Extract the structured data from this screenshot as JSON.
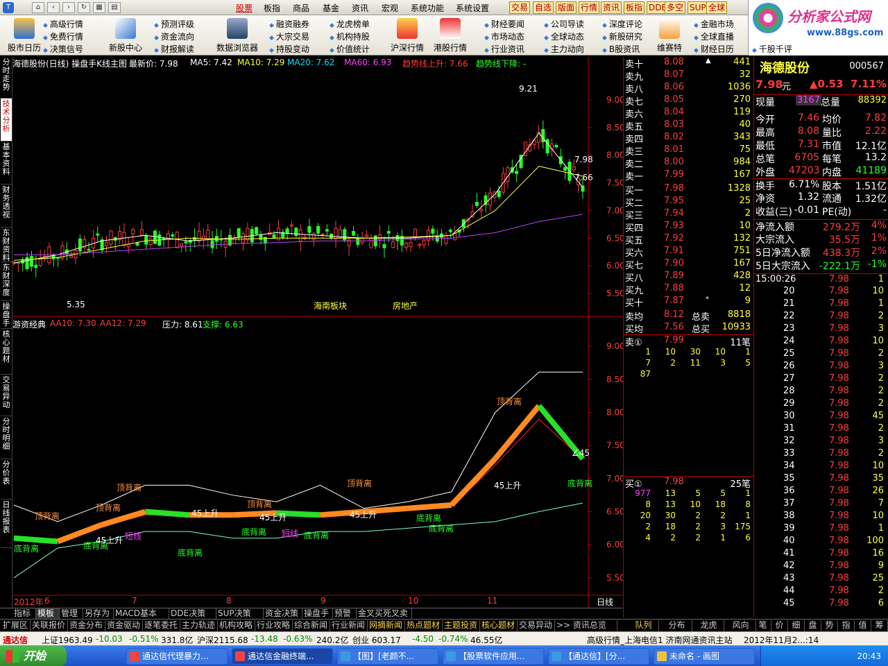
{
  "menu": {
    "items": [
      "股票",
      "板指",
      "商品",
      "基金",
      "资讯",
      "宏观",
      "系统功能",
      "系统设置"
    ],
    "active": "股票",
    "quick": [
      "交易",
      "自选",
      "版面",
      "行情",
      "资讯",
      "板指",
      "DDE",
      "多空",
      "SUP",
      "全球"
    ]
  },
  "toolbar": {
    "big": [
      "股市日历",
      "新股中心",
      "数据浏览器",
      "沪深行情",
      "港股行情",
      "维赛特"
    ],
    "small": [
      [
        "高级行情",
        "免费行情",
        "决策信号"
      ],
      [
        "预测评级",
        "资金流向",
        "财报解读"
      ],
      [
        "融资融券",
        "大宗交易",
        "持股变动"
      ],
      [
        "龙虎榜单",
        "机构持股",
        "价值统计"
      ],
      [
        "财经要闻",
        "市场动态",
        "行业资讯"
      ],
      [
        "公司导读",
        "全球动态",
        "主力动向"
      ],
      [
        "深度评论",
        "新股研究",
        "B股资讯"
      ],
      [
        "金融市场",
        "全球直播",
        "财经日历"
      ],
      [
        "千股千评"
      ]
    ]
  },
  "brand": {
    "title": "分析家公式网",
    "url": "www.88gs.com"
  },
  "side_tabs": [
    "分时走势",
    "技术分析",
    "基本资料",
    "财务透视",
    "东财资料",
    "东财深度",
    "操盘手",
    "核心题材",
    "交易异动",
    "分时明细",
    "分价表",
    "日线报表"
  ],
  "side_tab_active": "技术分析",
  "chart_header": {
    "title": "海德股份(日线) 操盘手K线主图",
    "last_label": "最新价: 7.98",
    "ma5": "MA5: 7.42",
    "ma10": "MA10: 7.29",
    "ma20": "MA20: 7.62",
    "ma60": "MA60: 6.93",
    "up": "趋势线上升: 7.66",
    "down": "趋势线下降: -"
  },
  "chart_labels": {
    "low": "5.35",
    "high": "9.21",
    "board1": "海南板块",
    "board2": "房地产",
    "right_last": "7.98",
    "right_trend": "7.66"
  },
  "sub_header": {
    "name": "游资经典",
    "aa10": "AA10: 7.30",
    "aa12": "AA12: 7.29",
    "pressure": "压力: 8.61",
    "support": "支撑: 6.63"
  },
  "sub_labels": {
    "top": [
      "顶背离",
      "顶背离",
      "顶背离",
      "顶背离",
      "顶背离",
      "顶背离"
    ],
    "bottom": [
      "底背离",
      "底背离",
      "底背离",
      "底背离",
      "底背离",
      "底背离",
      "底背离",
      "底背离"
    ],
    "up45": "45上升",
    "short": "短线",
    "corner": "∠45"
  },
  "chart_data": [
    {
      "type": "line",
      "title": "海德股份(日线) 操盘手K线主图",
      "xlabel": "",
      "ylabel": "",
      "ylim": [
        5.2,
        9.5
      ],
      "yticks": [
        "9.00",
        "8.50",
        "8.00",
        "7.50",
        "7.00",
        "6.50",
        "6.00",
        "5.50"
      ],
      "x": [
        "6",
        "7",
        "8",
        "9",
        "10",
        "11"
      ],
      "series": [
        {
          "name": "MA5",
          "values": [
            6.05,
            6.2,
            6.45,
            6.55,
            6.45,
            6.5,
            6.6,
            6.55,
            6.5,
            6.5,
            6.55,
            7.3,
            8.4,
            7.42
          ]
        },
        {
          "name": "MA20",
          "values": [
            6.1,
            6.15,
            6.3,
            6.45,
            6.5,
            6.48,
            6.5,
            6.5,
            6.5,
            6.52,
            6.55,
            7.0,
            7.8,
            7.62
          ]
        },
        {
          "name": "MA60",
          "values": [
            6.2,
            6.2,
            6.25,
            6.3,
            6.35,
            6.4,
            6.42,
            6.45,
            6.45,
            6.48,
            6.5,
            6.6,
            6.8,
            6.93
          ]
        }
      ]
    },
    {
      "type": "line",
      "title": "游资经典",
      "ylim": [
        5.3,
        9.2
      ],
      "yticks": [
        "9.00",
        "8.50",
        "8.00",
        "7.50",
        "7.00",
        "6.50",
        "6.00",
        "5.50"
      ],
      "series": [
        {
          "name": "AA10",
          "values": [
            6.1,
            6.05,
            6.3,
            6.5,
            6.45,
            6.45,
            6.48,
            6.45,
            6.5,
            6.55,
            6.6,
            7.3,
            8.1,
            7.3
          ]
        },
        {
          "name": "AA12",
          "values": [
            6.1,
            6.08,
            6.28,
            6.45,
            6.45,
            6.44,
            6.45,
            6.45,
            6.48,
            6.52,
            6.58,
            7.2,
            7.9,
            7.29
          ]
        },
        {
          "name": "压力",
          "values": [
            6.6,
            6.35,
            6.6,
            6.9,
            6.9,
            6.75,
            6.65,
            6.9,
            6.55,
            6.65,
            6.8,
            8.0,
            8.61,
            8.61
          ]
        },
        {
          "name": "支撑",
          "values": [
            5.5,
            5.95,
            6.05,
            6.2,
            6.2,
            6.1,
            6.1,
            6.2,
            6.2,
            6.25,
            6.3,
            6.35,
            6.5,
            6.63
          ]
        }
      ]
    }
  ],
  "x_axis": {
    "year": "2012年",
    "months": [
      "6",
      "7",
      "8",
      "9",
      "10",
      "11"
    ],
    "period": "日线"
  },
  "book": {
    "sells": [
      [
        "卖十",
        "8.08",
        "▲",
        "441"
      ],
      [
        "卖九",
        "8.07",
        "",
        "32"
      ],
      [
        "卖八",
        "8.06",
        "",
        "1036"
      ],
      [
        "卖七",
        "8.05",
        "",
        "270"
      ],
      [
        "卖六",
        "8.04",
        "",
        "119"
      ],
      [
        "卖五",
        "8.03",
        "",
        "40"
      ],
      [
        "卖四",
        "8.02",
        "",
        "343"
      ],
      [
        "卖三",
        "8.01",
        "",
        "75"
      ],
      [
        "卖二",
        "8.00",
        "",
        "984"
      ],
      [
        "卖一",
        "7.99",
        "",
        "167"
      ]
    ],
    "buys": [
      [
        "买一",
        "7.98",
        "",
        "1328"
      ],
      [
        "买二",
        "7.95",
        "",
        "25"
      ],
      [
        "买三",
        "7.94",
        "",
        "2"
      ],
      [
        "买四",
        "7.93",
        "",
        "10"
      ],
      [
        "买五",
        "7.92",
        "",
        "132"
      ],
      [
        "买六",
        "7.91",
        "",
        "751"
      ],
      [
        "买七",
        "7.90",
        "",
        "167"
      ],
      [
        "买八",
        "7.89",
        "",
        "428"
      ],
      [
        "买九",
        "7.88",
        "",
        "12"
      ],
      [
        "买十",
        "7.87",
        "*",
        "9"
      ]
    ],
    "avg_sell": [
      "卖均",
      "8.12",
      "总卖",
      "8818"
    ],
    "avg_buy": [
      "买均",
      "7.56",
      "总买",
      "10933"
    ],
    "sell_q": [
      "卖①",
      "7.99",
      "11笔"
    ],
    "sell_q_rows": [
      [
        "1",
        "10",
        "30",
        "10",
        "1"
      ],
      [
        "7",
        "2",
        "11",
        "3",
        "5"
      ],
      [
        "87",
        "",
        "",
        "",
        ""
      ]
    ],
    "buy_q": [
      "买①",
      "7.98",
      "25笔"
    ],
    "buy_q_rows": [
      [
        "977",
        "13",
        "5",
        "5",
        "1"
      ],
      [
        "8",
        "13",
        "10",
        "18",
        "8"
      ],
      [
        "20",
        "30",
        "2",
        "2",
        "1"
      ],
      [
        "2",
        "18",
        "2",
        "3",
        "175"
      ],
      [
        "4",
        "2",
        "2",
        "1",
        "6"
      ]
    ]
  },
  "quote": {
    "name": "海德股份",
    "code": "000567",
    "price": "7.98",
    "unit": "元",
    "change": "▲0.53",
    "pct": "7.11%",
    "xianliang_label": "现量",
    "xianliang": "3167",
    "zongliang_label": "总量",
    "zongliang": "88392",
    "fields": [
      [
        "今开",
        "7.46",
        "均价",
        "7.82"
      ],
      [
        "最高",
        "8.08",
        "量比",
        "2.22"
      ],
      [
        "最低",
        "7.31",
        "市值",
        "12.1亿"
      ],
      [
        "总笔",
        "6705",
        "每笔",
        "13.2"
      ],
      [
        "外盘",
        "47203",
        "内盘",
        "41189"
      ],
      [
        "换手",
        "6.71%",
        "股本",
        "1.51亿"
      ],
      [
        "净资",
        "1.32",
        "流通",
        "1.32亿"
      ],
      [
        "收益(三)",
        "-0.01",
        "PE(动)",
        "-"
      ]
    ],
    "flows": [
      [
        "净流入额",
        "279.2万",
        "4%"
      ],
      [
        "大宗流入",
        "35.5万",
        "1%"
      ],
      [
        "5日净流入额",
        "438.3万",
        "2%"
      ],
      [
        "5日大宗流入",
        "-222.1万",
        "-1%"
      ]
    ],
    "ticks": [
      [
        "15:00:26",
        "7.98",
        "1"
      ],
      [
        "20",
        "7.98",
        "10"
      ],
      [
        "21",
        "7.98",
        "1"
      ],
      [
        "22",
        "7.98",
        "2"
      ],
      [
        "23",
        "7.98",
        "3"
      ],
      [
        "24",
        "7.98",
        "10"
      ],
      [
        "25",
        "7.98",
        "2"
      ],
      [
        "26",
        "7.98",
        "3"
      ],
      [
        "27",
        "7.98",
        "2"
      ],
      [
        "28",
        "7.98",
        "2"
      ],
      [
        "29",
        "7.98",
        "2"
      ],
      [
        "30",
        "7.98",
        "45"
      ],
      [
        "31",
        "7.98",
        "2"
      ],
      [
        "32",
        "7.98",
        "3"
      ],
      [
        "33",
        "7.98",
        "2"
      ],
      [
        "34",
        "7.98",
        "10"
      ],
      [
        "35",
        "7.98",
        "35"
      ],
      [
        "36",
        "7.98",
        "26"
      ],
      [
        "37",
        "7.98",
        "7"
      ],
      [
        "38",
        "7.98",
        "10"
      ],
      [
        "39",
        "7.98",
        "1"
      ],
      [
        "40",
        "7.98",
        "100"
      ],
      [
        "41",
        "7.98",
        "16"
      ],
      [
        "42",
        "7.98",
        "9"
      ],
      [
        "43",
        "7.98",
        "25"
      ],
      [
        "44",
        "7.98",
        "2"
      ],
      [
        "45",
        "7.98",
        "6"
      ]
    ]
  },
  "bottom_tabs": [
    "指标",
    "模板",
    "管理",
    "另存为",
    "MACD基本",
    "DDE决策",
    "SUP决策",
    "资金决策",
    "操盘手",
    "预警",
    "金叉买死叉卖"
  ],
  "bottom_tab_active": "模板",
  "footer_tabs": [
    "扩展区",
    "关联报价",
    "资金分布",
    "资金驱动",
    "逐笔委托",
    "主力轨迹",
    "机构攻略",
    "行业攻略",
    "综合新闻",
    "行业新闻",
    "网摘新闻",
    "热点题材",
    "主题投资",
    "核心题材",
    "交易异动",
    ">> 资讯总览"
  ],
  "footer_right": [
    "队列",
    "分布",
    "龙虎",
    "风向",
    "笔",
    "价",
    "细",
    "盘",
    "势",
    "指",
    "值",
    "筹"
  ],
  "status": {
    "brand": "通达信",
    "sh": "上证1963.49",
    "sh_chg": "-10.03",
    "sh_pct": "-0.51%",
    "sh_amt": "331.8亿",
    "hs": "沪深2115.68",
    "hs_chg": "-13.48",
    "hs_pct": "-0.63%",
    "hs_amt": "240.2亿",
    "cy": "创业 603.17",
    "cy_chg": "-4.50",
    "cy_pct": "-0.74%",
    "cy_amt": "46.55亿",
    "server": "高级行情_上海电信1 济南网通资讯主站",
    "date": "2012年11月2...:14"
  },
  "taskbar": {
    "start": "开始",
    "items": [
      "通达信代理暴力...",
      "通达信金融终端...",
      "【图】[老颜不...",
      "【股票软件应用...",
      "【通达信】[分...",
      "未命名 - 画图"
    ],
    "time": "20:43"
  }
}
